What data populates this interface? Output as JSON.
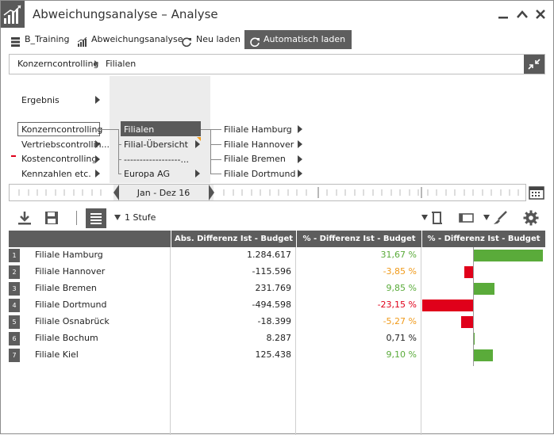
{
  "window": {
    "title": "Abweichungsanalyse – Analyse"
  },
  "toolbar": {
    "items": [
      {
        "label": "B_Training",
        "icon": "database-icon"
      },
      {
        "label": "Abweichungsanalyse",
        "icon": "chart-icon"
      },
      {
        "label": "Neu laden",
        "icon": "refresh-icon"
      },
      {
        "label": "Automatisch laden",
        "icon": "auto-refresh-icon",
        "active": true
      }
    ]
  },
  "breadcrumb": {
    "items": [
      "Konzerncontrolling",
      "Filialen"
    ]
  },
  "navigator": {
    "col1_top": "Ergebnis",
    "col1": [
      "Konzerncontrolling",
      "Vertriebscontrollin...",
      "Kostencontrolling",
      "Kennzahlen etc."
    ],
    "col2": [
      "Filialen",
      "Filial-Übersicht",
      "------------------...",
      "Europa AG"
    ],
    "col3": [
      "Filiale Hamburg",
      "Filiale Hannover",
      "Filiale Bremen",
      "Filiale Dortmund"
    ]
  },
  "timeline": {
    "period": "Jan - Dez 16"
  },
  "grid_toolbar": {
    "level_label": "1 Stufe"
  },
  "table": {
    "headers": [
      "Abs. Differenz Ist - Budget",
      "% - Differenz Ist - Budget",
      "% - Differenz Ist - Budget"
    ],
    "rows": [
      {
        "num": "1",
        "name": "Filiale Hamburg",
        "abs": "1.284.617",
        "pct": "31,67 %",
        "value": 31.67,
        "status": "positive"
      },
      {
        "num": "2",
        "name": "Filiale Hannover",
        "abs": "-115.596",
        "pct": "-3,85 %",
        "value": -3.85,
        "status": "warning"
      },
      {
        "num": "3",
        "name": "Filiale Bremen",
        "abs": "231.769",
        "pct": "9,85 %",
        "value": 9.85,
        "status": "positive"
      },
      {
        "num": "4",
        "name": "Filiale Dortmund",
        "abs": "-494.598",
        "pct": "-23,15 %",
        "value": -23.15,
        "status": "negative"
      },
      {
        "num": "5",
        "name": "Filiale Osnabrück",
        "abs": "-18.399",
        "pct": "-5,27 %",
        "value": -5.27,
        "status": "warning"
      },
      {
        "num": "6",
        "name": "Filiale Bochum",
        "abs": "8.287",
        "pct": "0,71 %",
        "value": 0.71,
        "status": "neutral"
      },
      {
        "num": "7",
        "name": "Filiale Kiel",
        "abs": "125.438",
        "pct": "9,10 %",
        "value": 9.1,
        "status": "positive"
      }
    ]
  },
  "colors": {
    "positive": "#5aab3a",
    "negative": "#e0001a",
    "warning": "#f09a1a",
    "neutral": "#222222",
    "header_bg": "#5d5d5d",
    "accent_dark": "#5a5a5a"
  }
}
